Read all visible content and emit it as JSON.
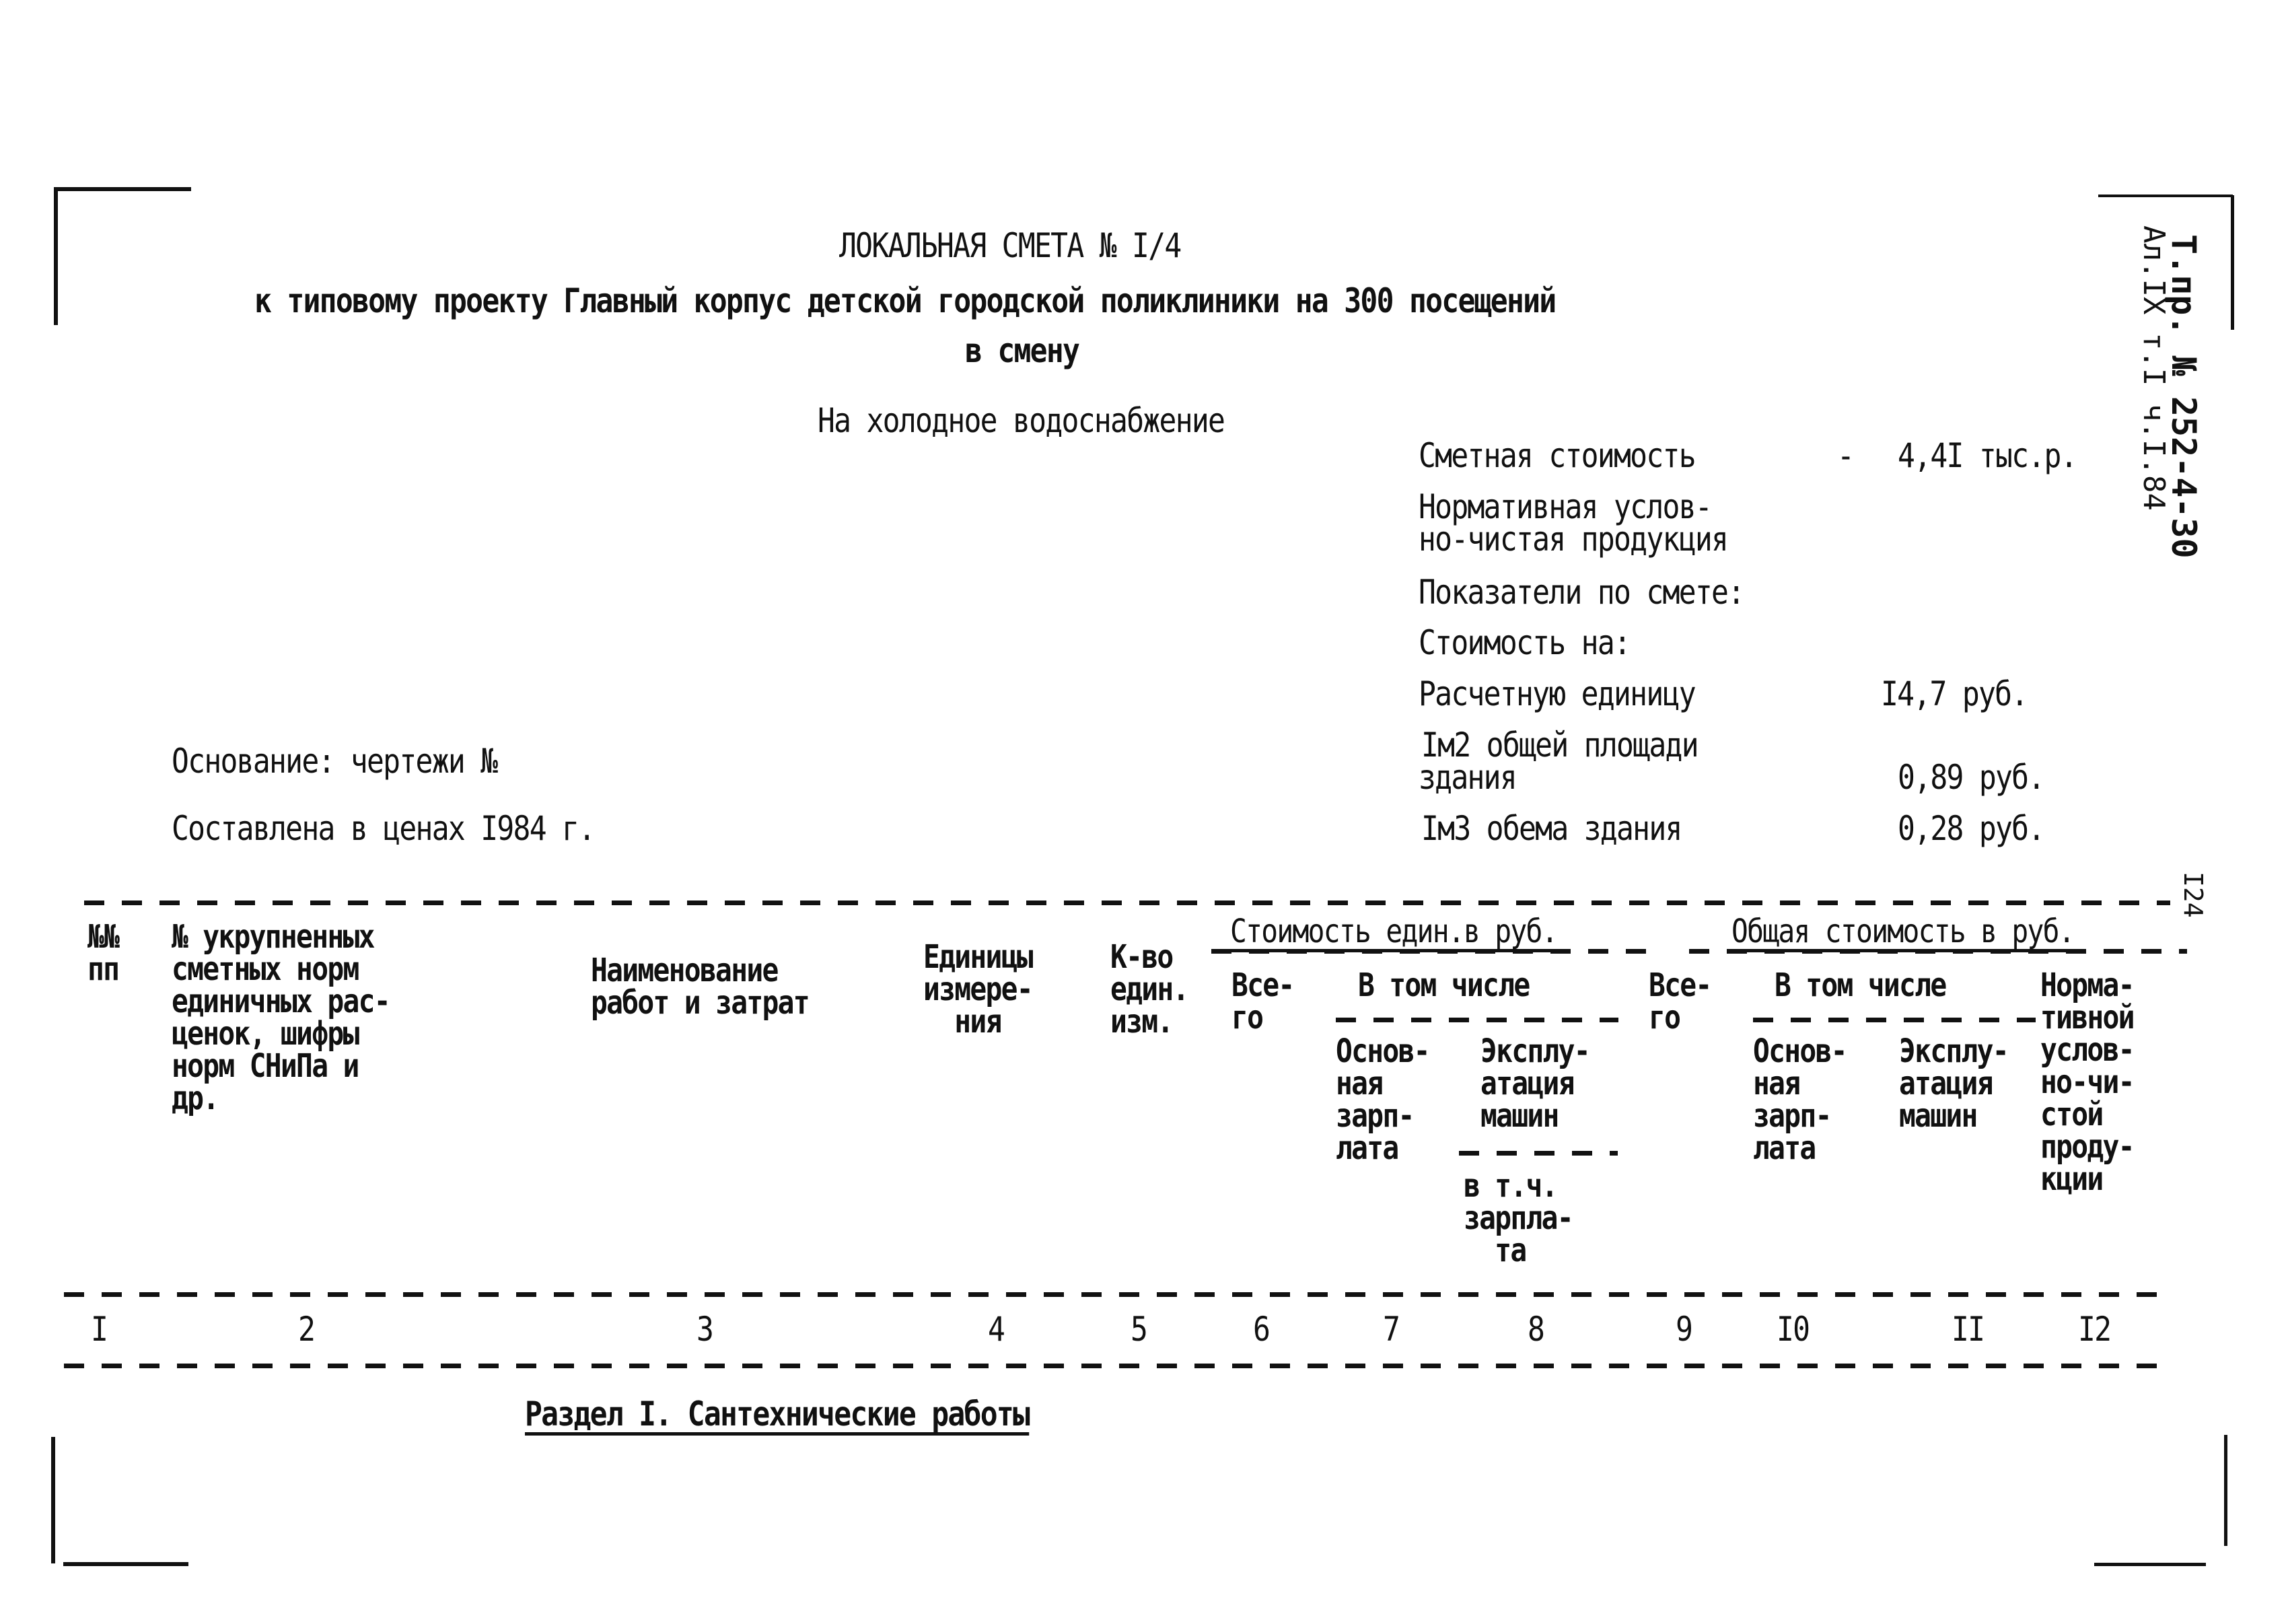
{
  "header": {
    "title": "ЛОКАЛЬНАЯ СМЕТА № I/4",
    "subtitle_line1": "к типовому проекту Главный корпус детской городской поликлиники на 300 посещений",
    "subtitle_line2": "в смену",
    "work_type": "На холодное водоснабжение"
  },
  "stamp": {
    "line1": "Т.пр. № 252-4-30",
    "line2": "Ал.IX т.I ч.I.84"
  },
  "page_number": "I24",
  "summary": {
    "estimated_cost_label": "Сметная стоимость",
    "estimated_cost_dash": "-",
    "estimated_cost_value": "4,4I тыс.р.",
    "normative_label_line1": "Нормативная услов-",
    "normative_label_line2": "но-чистая продукция",
    "indicators_label": "Показатели по смете:",
    "cost_for_label": "Стоимость на:",
    "per_unit_label": "Расчетную единицу",
    "per_unit_value": "I4,7 руб.",
    "per_m2_label_line1": "Iм2 общей площади",
    "per_m2_label_line2": "здания",
    "per_m2_value": "0,89 руб.",
    "per_m3_label": "Iм3 обема здания",
    "per_m3_value": "0,28 руб."
  },
  "basis": {
    "drawings": "Основание: чертежи №",
    "prices": "Составлена в ценах I984 г."
  },
  "table": {
    "col_headers": {
      "c1": "№№\nпп",
      "c2": "№ укрупненных\nсметных норм\nединичных рас-\nценок, шифры\nнорм СНиПа и\nдр.",
      "c3": "Наименование\nработ и затрат",
      "c4": "Единицы\nизмере-\n  ния",
      "c5": "К-во\nедин.\nизм.",
      "unit_cost_group": "Стоимость един.в руб.",
      "total_cost_group": "Общая стоимость в руб.",
      "c6": "Все-\nго",
      "c7_8_group": "В том числе",
      "c7": "Основ-\nная\nзарп-\nлата",
      "c8": "Эксплу-\nатация\nмашин",
      "c8_sub": "в т.ч.\nзарпла-\n  та",
      "c9": "Все-\nго",
      "c10_11_group": "В том числе",
      "c10": "Основ-\nная\nзарп-\nлата",
      "c11": "Эксплу-\nатация\nмашин",
      "c12": "Норма-\nтивной\nуслов-\nно-чи-\nстой\nпроду-\nкции"
    },
    "col_numbers": [
      "I",
      "2",
      "3",
      "4",
      "5",
      "6",
      "7",
      "8",
      "9",
      "I0",
      "II",
      "I2"
    ]
  },
  "section_title": "Раздел I. Сантехнические работы"
}
